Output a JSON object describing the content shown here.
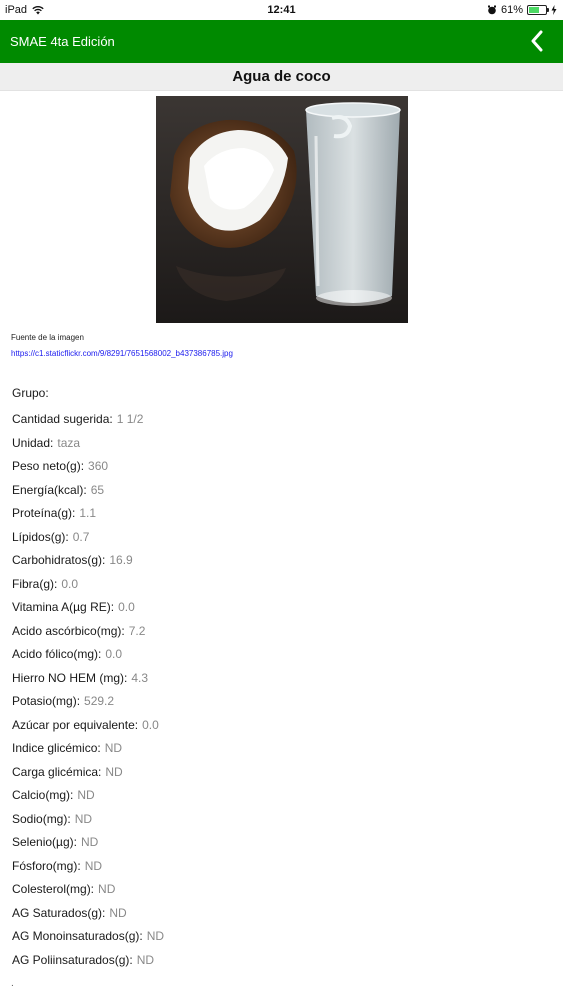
{
  "status_bar": {
    "device": "iPad",
    "time": "12:41",
    "battery": "61%",
    "battery_level": 0.61
  },
  "app_bar": {
    "title": "SMAE 4ta Edición",
    "back_icon": "chevron-left-icon"
  },
  "food": {
    "name": "Agua de coco"
  },
  "image_source": {
    "label": "Fuente de la imagen",
    "url": "https://c1.staticflickr.com/9/8291/7651568002_b437386785.jpg"
  },
  "nutrients": [
    {
      "label": "Grupo:",
      "value": ""
    },
    {
      "label": "Cantidad sugerida:",
      "value": "1 1/2"
    },
    {
      "label": "Unidad:",
      "value": "taza"
    },
    {
      "label": "Peso neto(g):",
      "value": "360"
    },
    {
      "label": "Energía(kcal):",
      "value": "65"
    },
    {
      "label": "Proteína(g):",
      "value": "1.1"
    },
    {
      "label": "Lípidos(g):",
      "value": "0.7"
    },
    {
      "label": "Carbohidratos(g):",
      "value": "16.9"
    },
    {
      "label": "Fibra(g):",
      "value": "0.0"
    },
    {
      "label": "Vitamina A(µg RE):",
      "value": "0.0"
    },
    {
      "label": "Acido ascórbico(mg):",
      "value": "7.2"
    },
    {
      "label": "Acido fólico(mg):",
      "value": "0.0"
    },
    {
      "label": "Hierro NO HEM (mg):",
      "value": "4.3"
    },
    {
      "label": "Potasio(mg):",
      "value": "529.2"
    },
    {
      "label": "Azúcar por equivalente:",
      "value": "0.0"
    },
    {
      "label": "Indice glicémico:",
      "value": "ND"
    },
    {
      "label": "Carga glicémica:",
      "value": "ND"
    },
    {
      "label": "Calcio(mg):",
      "value": "ND"
    },
    {
      "label": "Sodio(mg):",
      "value": "ND"
    },
    {
      "label": "Selenio(µg):",
      "value": "ND"
    },
    {
      "label": "Fósforo(mg):",
      "value": "ND"
    },
    {
      "label": "Colesterol(mg):",
      "value": "ND"
    },
    {
      "label": "AG Saturados(g):",
      "value": "ND"
    },
    {
      "label": "AG Monoinsaturados(g):",
      "value": "ND"
    },
    {
      "label": "AG Poliinsaturados(g):",
      "value": "ND"
    }
  ],
  "colors": {
    "app_bar": "#008a00",
    "title_bar": "#eeeeee",
    "value_text": "#888888",
    "link": "#1a1aee"
  }
}
